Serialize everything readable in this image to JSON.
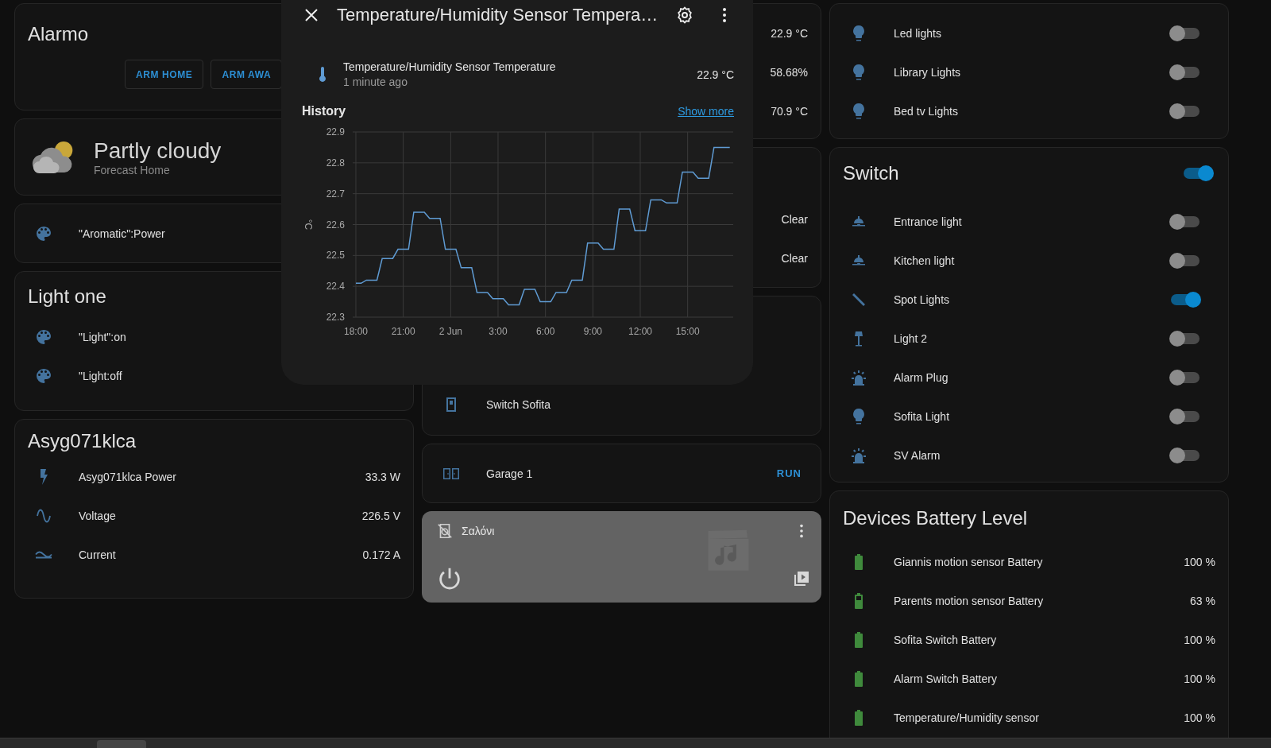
{
  "alarm_panel": {
    "title": "Alarmo",
    "buttons": [
      {
        "label": "ARM HOME"
      },
      {
        "label": "ARM AWA"
      }
    ]
  },
  "weather": {
    "condition": "Partly cloudy",
    "name": "Forecast Home"
  },
  "aromatic": {
    "entities": [
      {
        "kind": "palette",
        "name": "\"Aromatic\":Power"
      }
    ]
  },
  "light_one": {
    "title": "Light one",
    "entities": [
      {
        "kind": "palette",
        "name": "\"Light\":on"
      },
      {
        "kind": "palette",
        "name": "\"Light:off"
      }
    ]
  },
  "asyg": {
    "title": "Asyg071klca",
    "entities": [
      {
        "kind": "bolt",
        "name": "Asyg071klca Power",
        "value": "33.3 W"
      },
      {
        "kind": "sine",
        "name": "Voltage",
        "value": "226.5 V"
      },
      {
        "kind": "wave",
        "name": "Current",
        "value": "0.172 A"
      }
    ]
  },
  "sensors_card": {
    "values": [
      "22.9 °C",
      "58.68%",
      "70.9 °C"
    ]
  },
  "status_card": {
    "values": [
      "Clear",
      "Clear"
    ]
  },
  "switch_sofita": {
    "entities": [
      {
        "kind": "wallswitch",
        "name": "Switch Sofita"
      }
    ]
  },
  "garage": {
    "kind": "garage",
    "name": "Garage 1",
    "action": "RUN"
  },
  "media_player": {
    "name": "Σαλόνι"
  },
  "lights_card": {
    "entities": [
      {
        "kind": "bulb",
        "name": "Led lights",
        "on": false
      },
      {
        "kind": "bulb",
        "name": "Library Lights",
        "on": false
      },
      {
        "kind": "bulb",
        "name": "Bed tv Lights",
        "on": false
      }
    ]
  },
  "switch_card": {
    "title": "Switch",
    "on": true,
    "entities": [
      {
        "kind": "ceiling",
        "name": "Entrance light",
        "on": false
      },
      {
        "kind": "ceiling",
        "name": "Kitchen light",
        "on": false
      },
      {
        "kind": "spot",
        "name": "Spot Lights",
        "on": true
      },
      {
        "kind": "floorlamp",
        "name": "Light 2",
        "on": false
      },
      {
        "kind": "siren",
        "name": "Alarm Plug",
        "on": false
      },
      {
        "kind": "bulb",
        "name": "Sofita Light",
        "on": false
      },
      {
        "kind": "siren",
        "name": "SV Alarm",
        "on": false
      }
    ]
  },
  "battery_card": {
    "title": "Devices Battery Level",
    "entities": [
      {
        "kind": "battery_full",
        "name": "Giannis motion sensor Battery",
        "value": "100 %"
      },
      {
        "kind": "battery_partial",
        "name": "Parents motion sensor Battery",
        "value": "63 %"
      },
      {
        "kind": "battery_full",
        "name": "Sofita Switch Battery",
        "value": "100 %"
      },
      {
        "kind": "battery_full",
        "name": "Alarm Switch Battery",
        "value": "100 %"
      },
      {
        "kind": "battery_full",
        "name": "Temperature/Humidity sensor",
        "value": "100 %"
      }
    ]
  },
  "dialog": {
    "title": "Temperature/Humidity Sensor Tempera…",
    "entity": {
      "kind": "thermometer",
      "name": "Temperature/Humidity Sensor Temperature",
      "updated": "1 minute ago",
      "value": "22.9 °C"
    },
    "history": {
      "title": "History",
      "link": "Show more",
      "chart_data": {
        "type": "line",
        "ylabel": "°C",
        "ylim": [
          22.3,
          22.9
        ],
        "yticks": [
          22.3,
          22.4,
          22.5,
          22.6,
          22.7,
          22.8,
          22.9
        ],
        "grid": true,
        "categories": [
          "18:00",
          null,
          null,
          null,
          null,
          null,
          null,
          null,
          null,
          "21:00",
          null,
          null,
          null,
          null,
          null,
          null,
          null,
          null,
          "2 Jun",
          null,
          null,
          null,
          null,
          null,
          null,
          null,
          null,
          "3:00",
          null,
          null,
          null,
          null,
          null,
          null,
          null,
          null,
          "6:00",
          null,
          null,
          null,
          null,
          null,
          null,
          null,
          null,
          "9:00",
          null,
          null,
          null,
          null,
          null,
          null,
          null,
          null,
          "12:00",
          null,
          null,
          null,
          null,
          null,
          null,
          null,
          null,
          "15:00",
          null,
          null,
          null,
          null,
          null,
          null,
          null,
          null
        ],
        "series": [
          {
            "color": "#5f9bd3",
            "values": [
              22.41,
              22.41,
              22.42,
              22.42,
              22.42,
              22.49,
              22.49,
              22.49,
              22.52,
              22.52,
              22.52,
              22.64,
              22.64,
              22.64,
              22.62,
              22.62,
              22.62,
              22.52,
              22.52,
              22.52,
              22.46,
              22.46,
              22.46,
              22.38,
              22.38,
              22.38,
              22.36,
              22.36,
              22.36,
              22.34,
              22.34,
              22.34,
              22.39,
              22.39,
              22.39,
              22.35,
              22.35,
              22.35,
              22.38,
              22.38,
              22.38,
              22.42,
              22.42,
              22.42,
              22.54,
              22.54,
              22.54,
              22.52,
              22.52,
              22.52,
              22.65,
              22.65,
              22.65,
              22.58,
              22.58,
              22.58,
              22.68,
              22.68,
              22.68,
              22.67,
              22.67,
              22.67,
              22.77,
              22.77,
              22.77,
              22.75,
              22.75,
              22.75,
              22.85,
              22.85,
              22.85,
              22.85
            ]
          }
        ]
      }
    }
  }
}
